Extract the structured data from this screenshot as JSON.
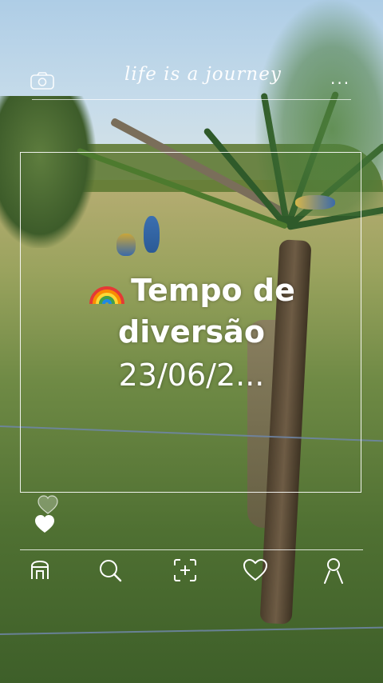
{
  "header": {
    "tagline": "life is a journey",
    "menu_dots": "...",
    "camera_icon": "camera-icon"
  },
  "post": {
    "title_line1": "Tempo de",
    "title_line2": "diversão",
    "date": "23/06/2...",
    "emoji": "rainbow-icon"
  },
  "reactions": {
    "icons": [
      "heart-outline-icon",
      "heart-filled-icon"
    ]
  },
  "nav": {
    "items": [
      {
        "name": "home",
        "icon": "home-icon"
      },
      {
        "name": "search",
        "icon": "search-icon"
      },
      {
        "name": "add",
        "icon": "add-post-icon"
      },
      {
        "name": "likes",
        "icon": "heart-icon"
      },
      {
        "name": "profile",
        "icon": "profile-icon"
      }
    ]
  },
  "colors": {
    "overlay_text": "#ffffff",
    "sky": "#aecde6",
    "grass": "#5d7a3c"
  }
}
